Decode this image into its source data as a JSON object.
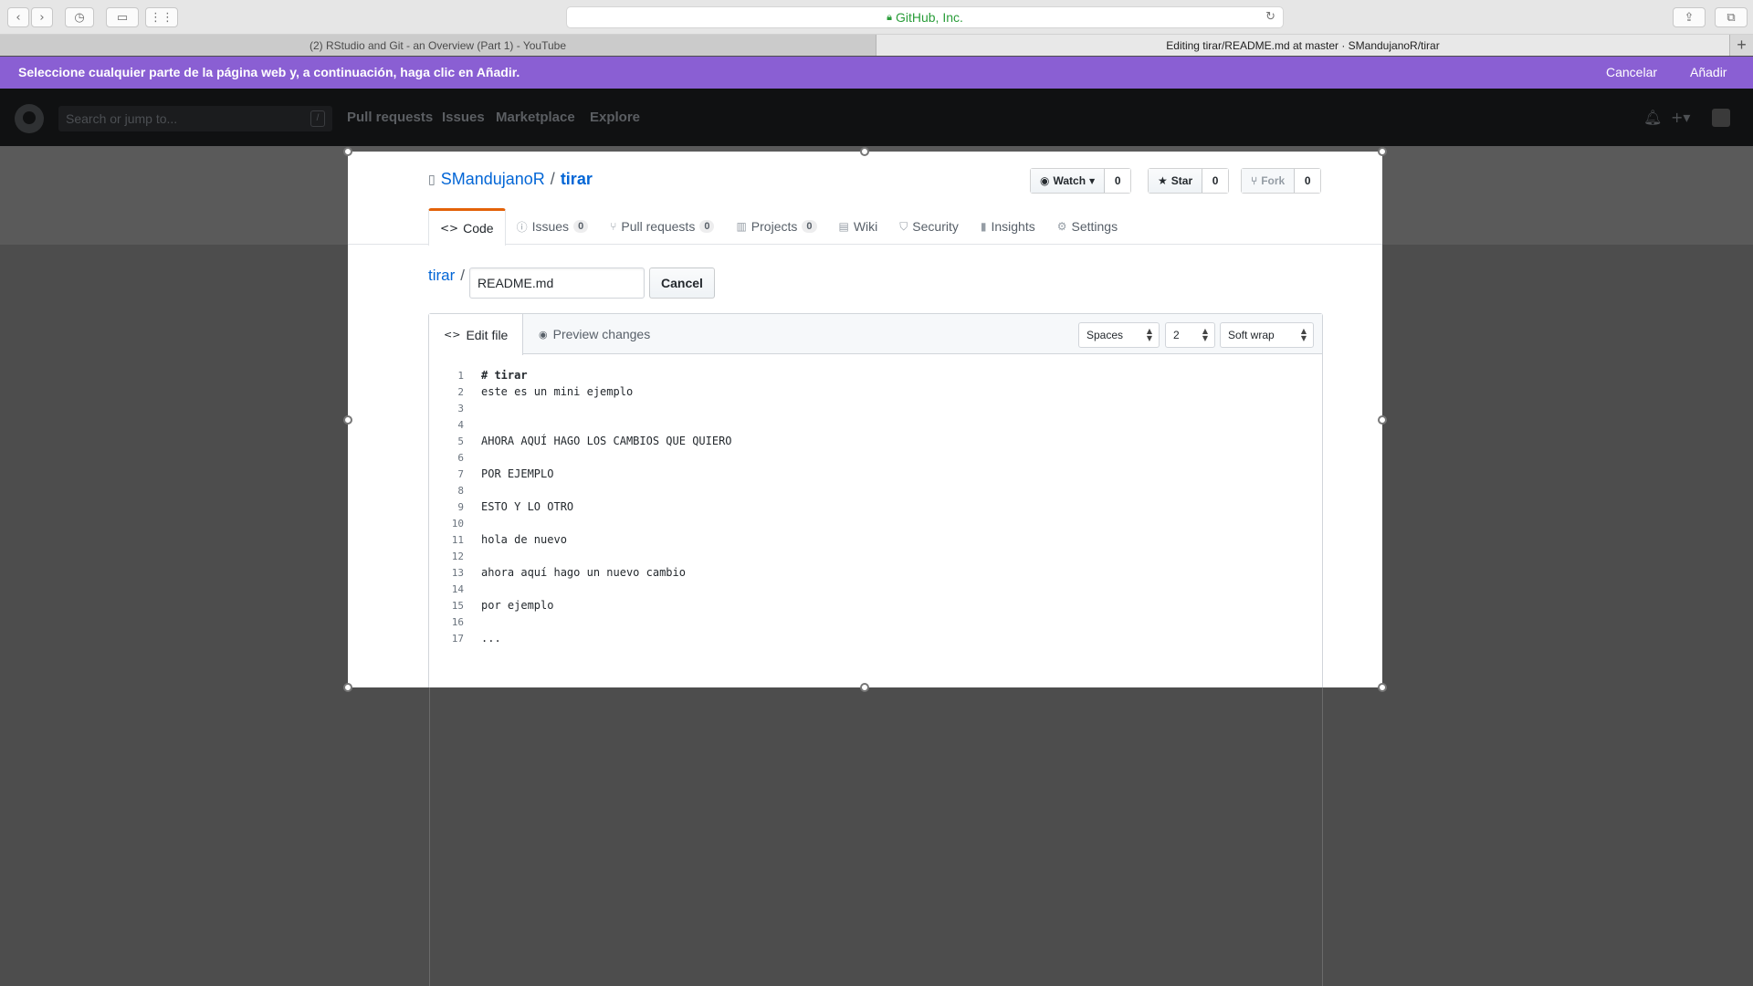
{
  "browser": {
    "url_label": "GitHub, Inc.",
    "tabs": [
      {
        "label": "(2) RStudio and Git - an Overview (Part 1) - YouTube"
      },
      {
        "label": "Editing tirar/README.md at master · SMandujanoR/tirar"
      }
    ]
  },
  "banner": {
    "message": "Seleccione cualquier parte de la página web y, a continuación, haga clic en Añadir.",
    "cancel": "Cancelar",
    "add": "Añadir"
  },
  "header": {
    "search_placeholder": "Search or jump to...",
    "search_key": "/",
    "nav": [
      "Pull requests",
      "Issues",
      "Marketplace",
      "Explore"
    ]
  },
  "repo": {
    "owner": "SMandujanoR",
    "separator": "/",
    "name": "tirar",
    "watch": {
      "label": "Watch",
      "count": "0"
    },
    "star": {
      "label": "Star",
      "count": "0"
    },
    "fork": {
      "label": "Fork",
      "count": "0"
    }
  },
  "reponav": {
    "code": "Code",
    "issues": "Issues",
    "issues_count": "0",
    "pulls": "Pull requests",
    "pulls_count": "0",
    "projects": "Projects",
    "projects_count": "0",
    "wiki": "Wiki",
    "security": "Security",
    "insights": "Insights",
    "settings": "Settings"
  },
  "edit": {
    "breadcrumb_root": "tirar",
    "breadcrumb_sep": "/",
    "filename": "README.md",
    "cancel": "Cancel",
    "tab_edit": "Edit file",
    "tab_preview": "Preview changes",
    "indent_mode": "Spaces",
    "indent_size": "2",
    "wrap_mode": "Soft wrap"
  },
  "code_lines": [
    "# tirar",
    "este es un mini ejemplo",
    "",
    "",
    "AHORA AQUÍ HAGO LOS CAMBIOS QUE QUIERO",
    "",
    "POR EJEMPLO",
    "",
    "ESTO Y LO OTRO",
    "",
    "hola de nuevo",
    "",
    "ahora aquí hago un nuevo cambio",
    "",
    "por ejemplo",
    "",
    "..."
  ],
  "colors": {
    "banner": "#8a5fd3",
    "link": "#0366d6",
    "selected_tab_accent": "#e36209",
    "url_secure": "#2a9d3a"
  }
}
